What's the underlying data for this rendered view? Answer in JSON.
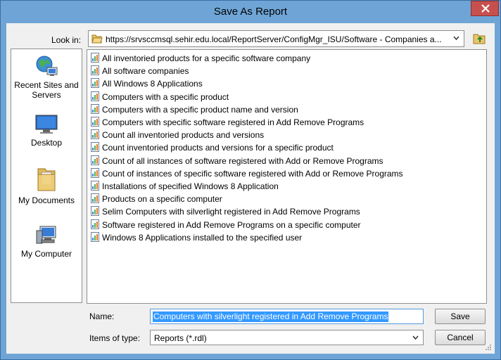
{
  "window": {
    "title": "Save As Report"
  },
  "lookin": {
    "label": "Look in:",
    "path": "https://srvsccmsql.sehir.edu.local/ReportServer/ConfigMgr_ISU/Software - Companies a..."
  },
  "places": [
    {
      "label": "Recent Sites and Servers",
      "icon": "globe-computer-icon"
    },
    {
      "label": "Desktop",
      "icon": "desktop-icon"
    },
    {
      "label": "My Documents",
      "icon": "documents-folder-icon"
    },
    {
      "label": "My Computer",
      "icon": "computer-icon"
    }
  ],
  "files": [
    "All inventoried products for a specific software company",
    "All software companies",
    "All Windows 8 Applications",
    "Computers with a specific product",
    "Computers with a specific product name and version",
    "Computers with specific software registered in Add Remove Programs",
    "Count all inventoried products and versions",
    "Count inventoried products and versions for a specific product",
    "Count of all instances of software registered with Add or Remove Programs",
    "Count of instances of specific software registered with Add or Remove Programs",
    "Installations of specified Windows 8 Application",
    "Products on a specific computer",
    "Selim Computers with silverlight registered in Add Remove Programs",
    "Software registered in Add Remove Programs on a specific computer",
    "Windows 8 Applications installed to the specified user"
  ],
  "name_field": {
    "label": "Name:",
    "value": "Computers with silverlight registered in Add Remove Programs"
  },
  "type_field": {
    "label": "Items of type:",
    "value": "Reports (*.rdl)"
  },
  "buttons": {
    "save": "Save",
    "cancel": "Cancel"
  },
  "colors": {
    "titlebar": "#6fa5d6",
    "close": "#c7504f",
    "selection": "#3399ff"
  }
}
